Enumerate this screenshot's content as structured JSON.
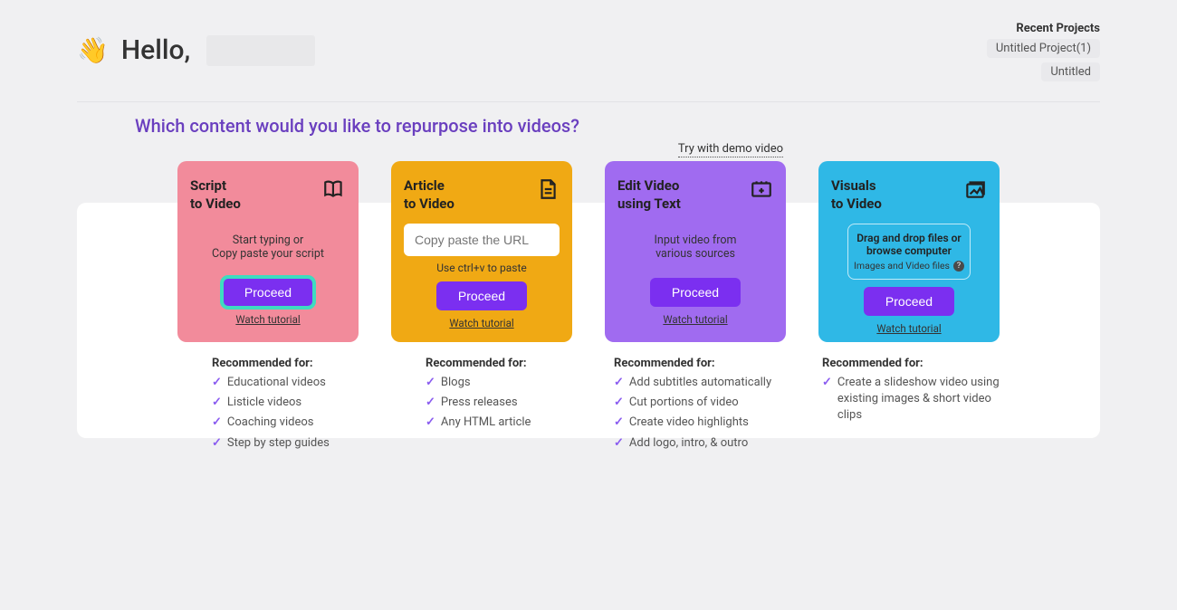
{
  "header": {
    "greeting_prefix": "Hello,",
    "recent_title": "Recent Projects",
    "recent_items": [
      "Untitled Project(1)",
      "Untitled"
    ]
  },
  "prompt": "Which content would you like to repurpose into videos?",
  "demo_link": "Try with demo video",
  "cards": [
    {
      "title_line1": "Script",
      "title_line2": "to Video",
      "body_line1": "Start typing or",
      "body_line2": "Copy paste your script",
      "proceed": "Proceed",
      "tutorial": "Watch tutorial",
      "rec_title": "Recommended for:",
      "rec": [
        "Educational videos",
        "Listicle videos",
        "Coaching videos",
        "Step by step guides"
      ]
    },
    {
      "title_line1": "Article",
      "title_line2": "to Video",
      "placeholder": "Copy paste the URL",
      "hint": "Use ctrl+v to paste",
      "proceed": "Proceed",
      "tutorial": "Watch tutorial",
      "rec_title": "Recommended for:",
      "rec": [
        "Blogs",
        "Press releases",
        "Any HTML article"
      ]
    },
    {
      "title_line1": "Edit Video",
      "title_line2": "using Text",
      "body_line1": "Input video from",
      "body_line2": "various sources",
      "proceed": "Proceed",
      "tutorial": "Watch tutorial",
      "rec_title": "Recommended for:",
      "rec": [
        "Add subtitles automatically",
        "Cut portions of video",
        "Create video highlights",
        "Add logo, intro, & outro"
      ]
    },
    {
      "title_line1": "Visuals",
      "title_line2": "to Video",
      "drop_line1": "Drag and drop files or",
      "drop_line2": "browse computer",
      "drop_sub": "Images and Video files",
      "proceed": "Proceed",
      "tutorial": "Watch tutorial",
      "rec_title": "Recommended for:",
      "rec": [
        "Create a slideshow video using existing images & short video clips"
      ]
    }
  ]
}
